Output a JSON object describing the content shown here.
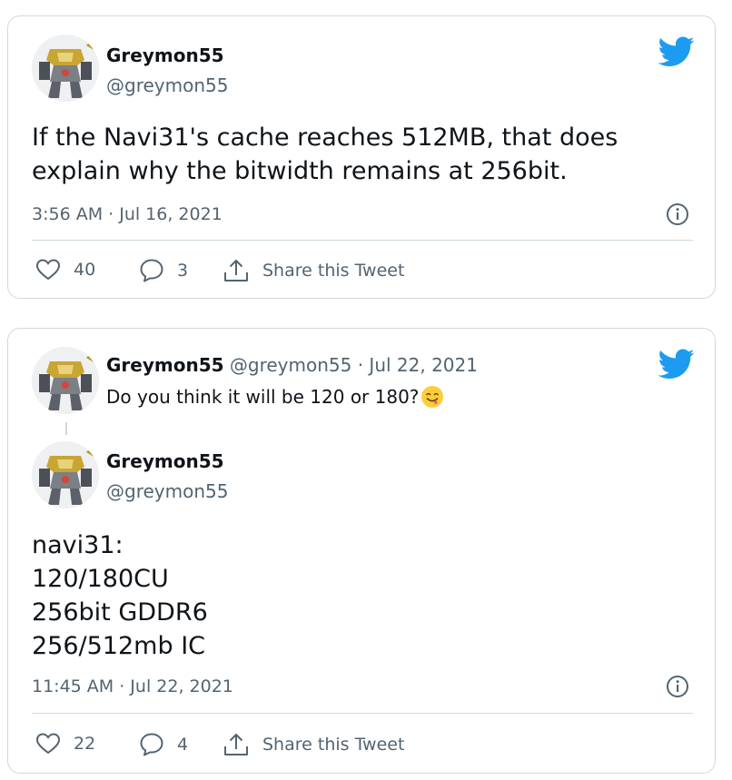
{
  "tweet1": {
    "display_name": "Greymon55",
    "handle": "@greymon55",
    "text_lines": [
      "If the Navi31's cache reaches 512MB, that does",
      "explain why the bitwidth remains at 256bit."
    ],
    "timestamp": "3:56 AM · Jul 16, 2021",
    "likes": "40",
    "replies": "3",
    "share_label": "Share this Tweet"
  },
  "tweet2": {
    "parent": {
      "display_name": "Greymon55",
      "handle": "@greymon55",
      "date": "· Jul 22, 2021",
      "text": "Do you think it will be 120 or 180?",
      "emoji": "face-savoring-food-emoji"
    },
    "main": {
      "display_name": "Greymon55",
      "handle": "@greymon55",
      "text_lines": [
        "navi31:",
        "120/180CU",
        "256bit GDDR6",
        "256/512mb IC"
      ],
      "timestamp": "11:45 AM · Jul 22, 2021",
      "likes": "22",
      "replies": "4",
      "share_label": "Share this Tweet"
    }
  },
  "colors": {
    "twitter_blue": "#1d9bf0",
    "text_primary": "#0f1419",
    "text_secondary": "#536471",
    "border": "#cfd9de"
  },
  "icons": [
    "twitter-bird-icon",
    "info-icon",
    "heart-icon",
    "reply-bubble-icon",
    "share-icon"
  ]
}
